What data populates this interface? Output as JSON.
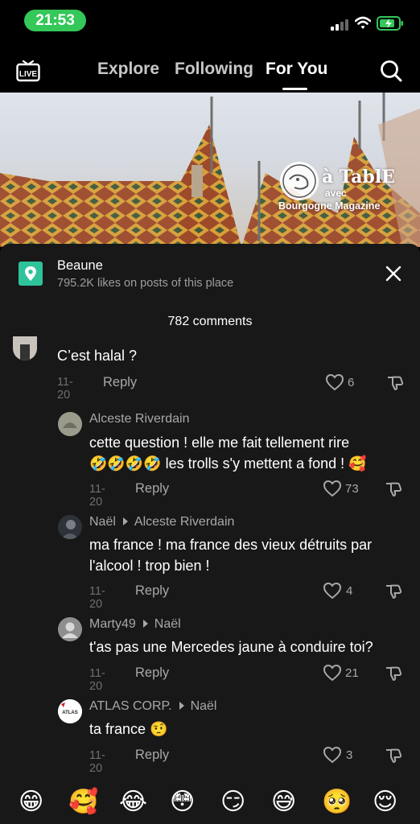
{
  "status": {
    "time": "21:53"
  },
  "nav": {
    "tabs": [
      "Explore",
      "Following",
      "For You"
    ],
    "active": "For You"
  },
  "video": {
    "brand_top": "à TablE",
    "brand_mid": "avec",
    "brand_bottom": "Bourgogne Magazine"
  },
  "place": {
    "name": "Beaune",
    "likes": "795.2K likes on posts of this place"
  },
  "comment_count": "782 comments",
  "comments": [
    {
      "username": "",
      "text": [
        "C’est halal ?"
      ],
      "date": "11-20",
      "reply": "Reply",
      "likes": "6"
    },
    {
      "username": "Alceste Riverdain",
      "reply_to": "",
      "text": [
        "cette question ! elle me fait tellement rire",
        "🤣🤣🤣🤣 les trolls s'y mettent a fond ! 🥰"
      ],
      "date": "11-20",
      "reply": "Reply",
      "likes": "73"
    },
    {
      "username": "Naël",
      "reply_to": "Alceste Riverdain",
      "text": [
        "ma france ! ma france des vieux détruits par",
        "l'alcool ! trop bien !"
      ],
      "date": "11-20",
      "reply": "Reply",
      "likes": "4"
    },
    {
      "username": "Marty49",
      "reply_to": "Naël",
      "text": [
        "t'as pas une Mercedes jaune à conduire toi?"
      ],
      "date": "11-20",
      "reply": "Reply",
      "likes": "21"
    },
    {
      "username": "ATLAS CORP.",
      "reply_to": "Naël",
      "avatar_text": "ATLAS",
      "text": [
        "ta france 🤨"
      ],
      "date": "11-20",
      "reply": "Reply",
      "likes": "3"
    }
  ],
  "emoji_bar": [
    "😁",
    "🥰",
    "😂",
    "😳",
    "😏",
    "😅",
    "🥺",
    "😌"
  ],
  "colors": {
    "status_pill": "#34c759",
    "place_icon": "#2ec39a",
    "sheet_bg": "#181818"
  },
  "icons": [
    "live-icon",
    "search-icon",
    "location-pin-icon",
    "close-icon",
    "heart-icon",
    "dislike-icon"
  ]
}
